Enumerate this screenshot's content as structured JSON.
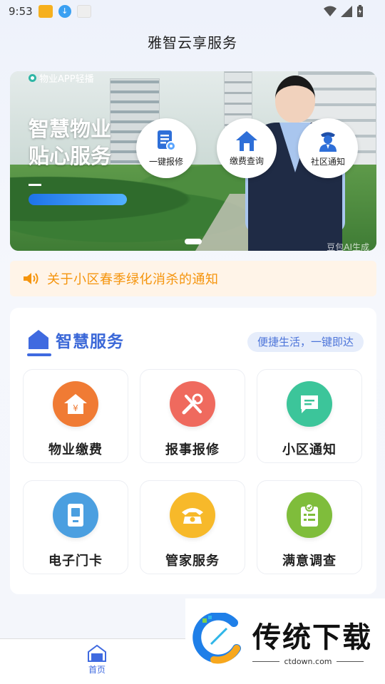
{
  "status_bar": {
    "time": "9:53"
  },
  "header": {
    "title": "雅智云享服务"
  },
  "banner": {
    "tag": "物业APP轻播",
    "headline_line1": "智慧物业",
    "headline_line2": "贴心服务",
    "quick_actions": [
      {
        "label": "一键报修",
        "icon": "document-pin-icon"
      },
      {
        "label": "缴费查询",
        "icon": "house-icon"
      },
      {
        "label": "社区通知",
        "icon": "officer-icon"
      }
    ],
    "watermark": "豆包AI生成"
  },
  "notice": {
    "text": "关于小区春季绿化消杀的通知",
    "icon": "speaker-icon"
  },
  "services": {
    "title": "智慧服务",
    "slogan": "便捷生活，一键即达",
    "items": [
      {
        "label": "物业缴费",
        "icon": "house-yen-icon",
        "color": "#f07b34"
      },
      {
        "label": "报事报修",
        "icon": "wrench-screwdriver-icon",
        "color": "#ef6a5e"
      },
      {
        "label": "小区通知",
        "icon": "message-icon",
        "color": "#3cc59a"
      },
      {
        "label": "电子门卡",
        "icon": "door-card-icon",
        "color": "#4b9fe0"
      },
      {
        "label": "管家服务",
        "icon": "phone-icon",
        "color": "#f7b92a"
      },
      {
        "label": "满意调查",
        "icon": "survey-clipboard-icon",
        "color": "#7fbd3b"
      }
    ]
  },
  "tabbar": {
    "home_label": "首页"
  },
  "overlay_watermark": {
    "title": "传统下载",
    "subtitle": "ctdown.com"
  }
}
